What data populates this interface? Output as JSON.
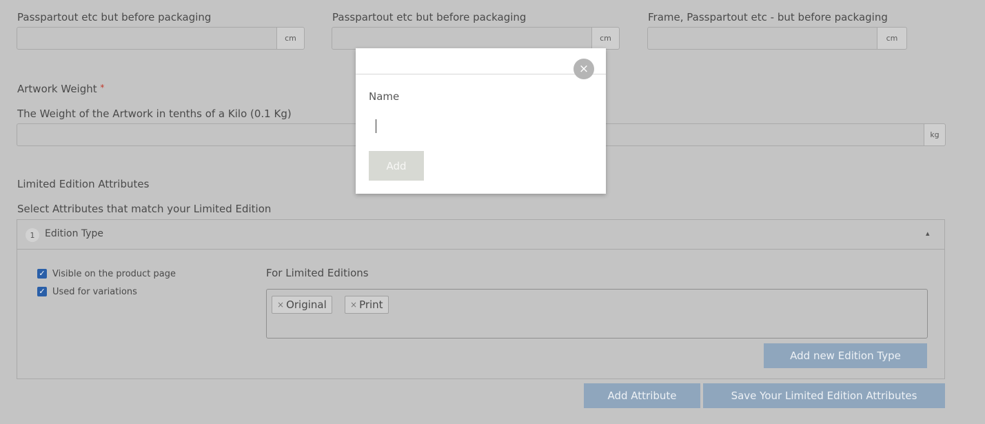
{
  "dimensions": {
    "col1_desc": "Passpartout etc but before packaging",
    "col2_desc": "Passpartout etc but before packaging",
    "col3_desc": "Frame, Passpartout etc - but before packaging",
    "unit": "cm"
  },
  "weight": {
    "label": "Artwork Weight",
    "required_mark": "*",
    "desc": "The Weight of the Artwork in tenths of a Kilo (0.1 Kg)",
    "unit": "kg"
  },
  "limited_edition": {
    "heading": "Limited Edition Attributes",
    "subheading": "Select Attributes that match your Limited Edition",
    "attribute": {
      "index": "1",
      "name": "Edition Type",
      "collapse_glyph": "▴",
      "visible_label": "Visible on the product page",
      "variations_label": "Used for variations",
      "values_label": "For Limited Editions",
      "tags": [
        "Original",
        "Print"
      ],
      "tag_remove_glyph": "×",
      "add_value_label": "Add new Edition Type"
    },
    "add_attribute_label": "Add Attribute",
    "save_label": "Save Your Limited Edition Attributes"
  },
  "modal": {
    "field_label": "Name",
    "add_label": "Add",
    "close_glyph": "×"
  },
  "colors": {
    "overlay_bg": "#c4c4c4",
    "checkbox": "#2a5fa8",
    "button": "#8fa6bd",
    "required": "#c0392b"
  }
}
